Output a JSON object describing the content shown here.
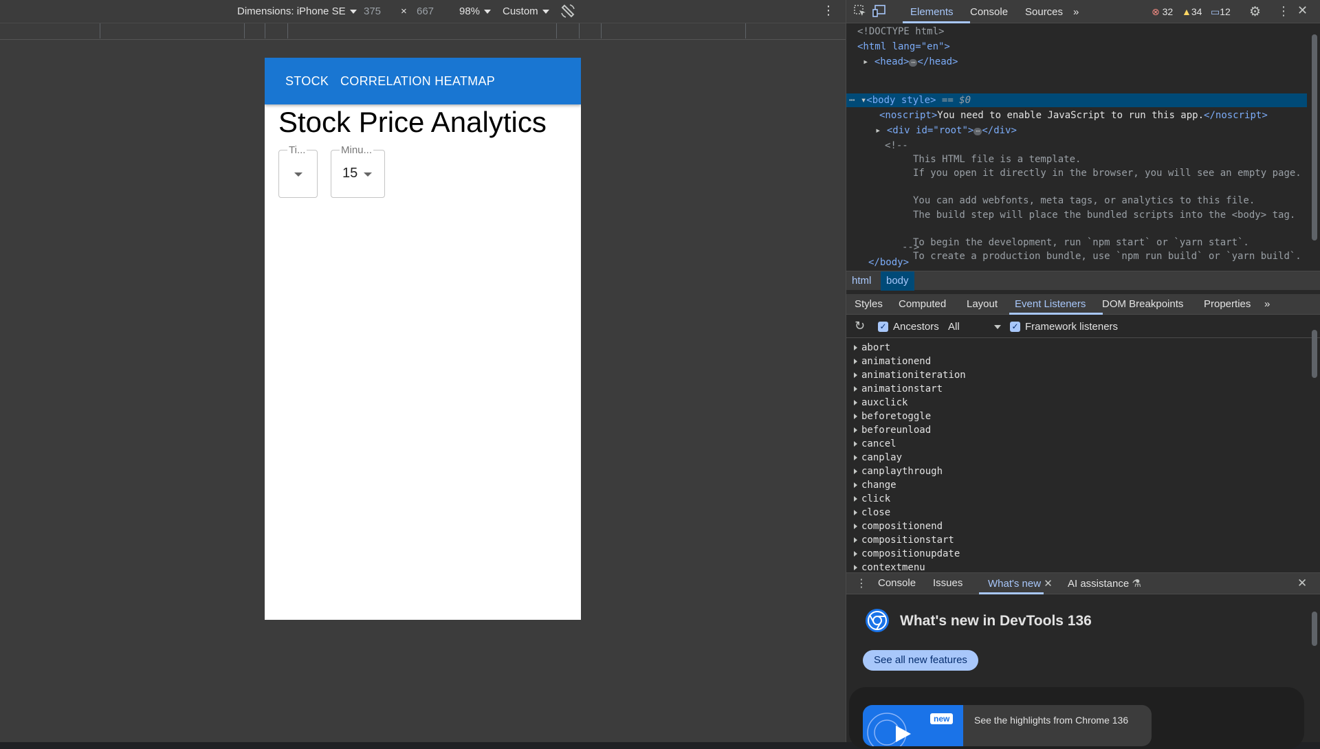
{
  "emulation": {
    "device_label": "Dimensions: iPhone SE",
    "width": "375",
    "times": "×",
    "height": "667",
    "zoom": "98%",
    "throttle": "Custom"
  },
  "app": {
    "nav": [
      "STOCK",
      "CORRELATION HEATMAP"
    ],
    "title": "Stock Price Analytics",
    "select1_label": "Ti...",
    "select1_value": "",
    "select2_label": "Minu...",
    "select2_value": "15",
    "appbar_color": "#1976d2"
  },
  "devtools": {
    "tabs": [
      "Elements",
      "Console",
      "Sources"
    ],
    "errors": "32",
    "warnings": "34",
    "messages": "12",
    "dom_lines": {
      "doctype": "<!DOCTYPE html>",
      "html_open": "<html lang=\"en\">",
      "head": "<head>",
      "head_close": "</head>",
      "body": "<body style>",
      "body_suffix": "== $0",
      "noscript_open": "<noscript>",
      "noscript_text": "You need to enable JavaScript to run this app.",
      "noscript_close": "</noscript>",
      "div_root": "<div id=\"root\">",
      "div_close": "</div>",
      "comment_open": "<!--",
      "c1": "This HTML file is a template.",
      "c2": "If you open it directly in the browser, you will see an empty page.",
      "c3": "You can add webfonts, meta tags, or analytics to this file.",
      "c4": "The build step will place the bundled scripts into the <body> tag.",
      "c5": "To begin the development, run `npm start` or `yarn start`.",
      "c6": "To create a production bundle, use `npm run build` or `yarn build`.",
      "comment_close": "-->",
      "body_close": "</body>"
    },
    "breadcrumbs": [
      "html",
      "body"
    ],
    "subtabs": [
      "Styles",
      "Computed",
      "Layout",
      "Event Listeners",
      "DOM Breakpoints",
      "Properties"
    ],
    "ancestors": "Ancestors",
    "filter": "All",
    "framework": "Framework listeners",
    "events": [
      "abort",
      "animationend",
      "animationiteration",
      "animationstart",
      "auxclick",
      "beforetoggle",
      "beforeunload",
      "cancel",
      "canplay",
      "canplaythrough",
      "change",
      "click",
      "close",
      "compositionend",
      "compositionstart",
      "compositionupdate",
      "contextmenu"
    ],
    "drawer_tabs": [
      "Console",
      "Issues",
      "What's new",
      "AI assistance"
    ],
    "whats_new_title": "What's new in DevTools 136",
    "see_all": "See all new features",
    "highlight_badge": "new",
    "highlight_text": "See the highlights from Chrome 136"
  }
}
